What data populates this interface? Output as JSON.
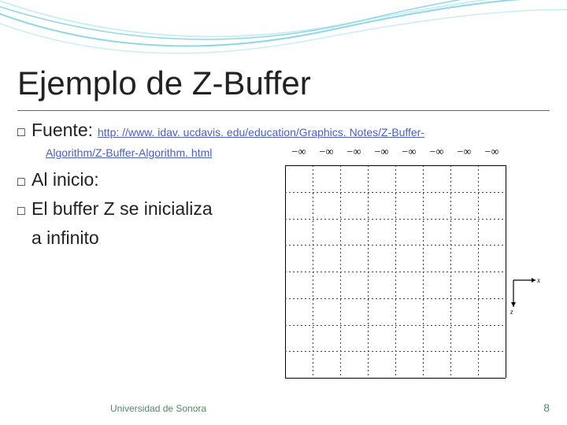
{
  "decor": {
    "curve_stroke": "#8fd7e6",
    "curve_stroke_light": "#c9eef5"
  },
  "title": "Ejemplo de Z-Buffer",
  "bullets": {
    "marker": "□",
    "fuente_label": "Fuente:",
    "link_part1": "http: //www. idav. ucdavis. edu/education/Graphics. Notes/Z-Buffer-",
    "link_part2": "Algorithm/Z-Buffer-Algorithm. html",
    "line2": "Al inicio:",
    "line3": "El buffer Z se inicializa",
    "line3b": "a infinito"
  },
  "diagram": {
    "cols": 8,
    "rows": 8,
    "cell_label": "−∞",
    "axis_x": "x⃗",
    "axis_z": "z⃗"
  },
  "footer": {
    "left": "Universidad de Sonora",
    "right": "8"
  }
}
